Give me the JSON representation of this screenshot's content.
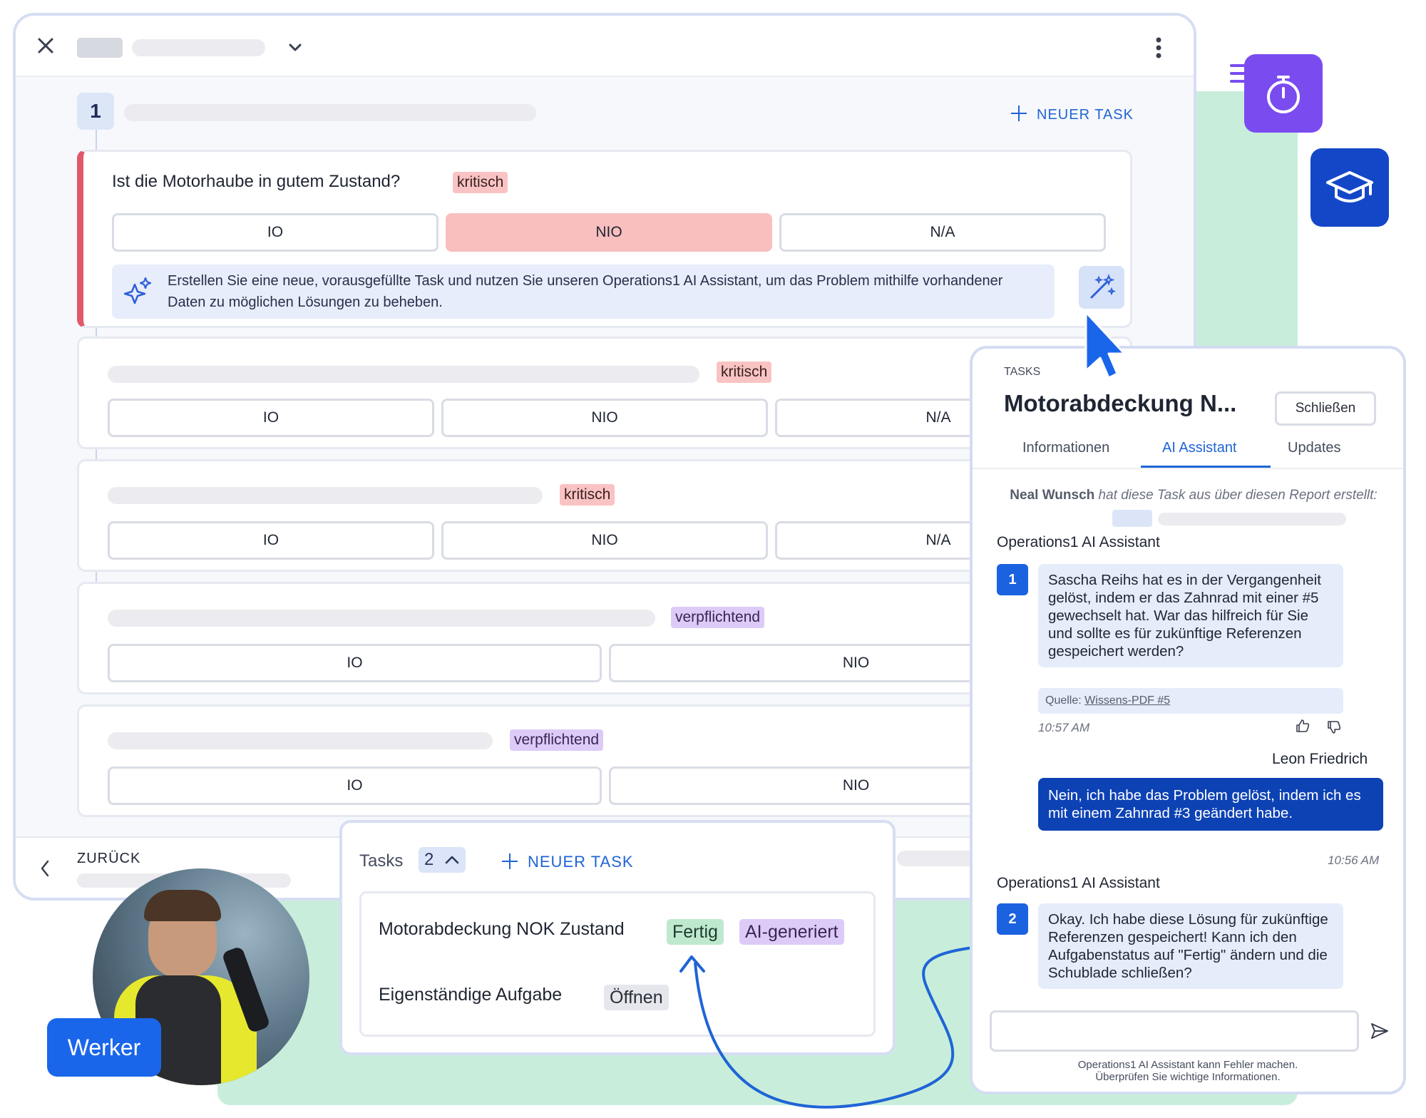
{
  "colors": {
    "accent": "#1f64d6",
    "critical": "#fac3c3",
    "mandatory": "#dccbf7",
    "done": "#bfe9cf",
    "panel_user": "#0d42b5",
    "timer_tile": "#7a4cf0",
    "edu_tile": "#1447c8"
  },
  "icons": {
    "close": "close-icon",
    "chevron": "chevron-down-icon",
    "menu": "more-vertical-icon",
    "timer": "stopwatch-icon",
    "edu": "graduation-cap-icon",
    "sparkle": "sparkles-icon",
    "wand": "magic-wand-icon",
    "cursor": "cursor-arrow-icon",
    "send": "send-icon",
    "thumbs_up": "thumbs-up-icon",
    "thumbs_down": "thumbs-down-icon",
    "back": "chevron-left-icon",
    "up": "chevron-up-icon"
  },
  "step": {
    "number": "1",
    "new_task": "NEUER TASK"
  },
  "questions": [
    {
      "title": "Ist die Motorhaube in gutem Zustand?",
      "tag": "kritisch",
      "options": [
        "IO",
        "NIO",
        "N/A"
      ],
      "selected": "NIO"
    },
    {
      "tag": "kritisch",
      "options": [
        "IO",
        "NIO",
        "N/A"
      ]
    },
    {
      "tag": "kritisch",
      "options": [
        "IO",
        "NIO",
        "N/A"
      ]
    },
    {
      "tag": "verpflichtend",
      "options": [
        "IO",
        "NIO"
      ]
    },
    {
      "tag": "verpflichtend",
      "options": [
        "IO",
        "NIO"
      ]
    }
  ],
  "ai_hint": "Erstellen Sie eine neue, vorausgefüllte Task und nutzen Sie unseren Operations1 AI Assistant, um das Problem mithilfe vorhandener Daten zu möglichen Lösungen zu beheben.",
  "footer": {
    "back": "ZURÜCK"
  },
  "tasks_popup": {
    "title": "Tasks",
    "count": "2",
    "new_task": "NEUER TASK",
    "items": [
      {
        "name": "Motorabdeckung NOK Zustand",
        "status": "Fertig",
        "badge": "AI-generiert"
      },
      {
        "name": "Eigenständige Aufgabe",
        "status": "Öffnen"
      }
    ]
  },
  "panel": {
    "eyebrow": "TASKS",
    "title": "Motorabdeckung N...",
    "close": "Schließen",
    "tabs": [
      "Informationen",
      "AI Assistant",
      "Updates"
    ],
    "active_tab": "AI Assistant",
    "created_by": "Neal Wunsch",
    "created_text": "hat diese Task aus über diesen Report erstellt:",
    "messages": [
      {
        "sender": "Operations1 AI Assistant",
        "number": "1",
        "text": "Sascha Reihs hat es in der Vergangenheit gelöst, indem er das Zahnrad mit einer #5 gewechselt hat. War das hilfreich für Sie und sollte es für zukünftige Referenzen gespeichert werden?",
        "source_label": "Quelle:",
        "source_link": "Wissens-PDF #5",
        "time": "10:57 AM"
      },
      {
        "sender": "Leon Friedrich",
        "text": "Nein, ich habe das Problem gelöst, indem ich es mit einem Zahnrad #3 geändert habe.",
        "time": "10:56 AM"
      },
      {
        "sender": "Operations1 AI Assistant",
        "number": "2",
        "text": "Okay. Ich habe diese Lösung für zukünftige Referenzen gespeichert! Kann ich den Aufgabenstatus auf \"Fertig\" ändern und die Schublade schließen?"
      }
    ],
    "input_placeholder": "",
    "disclaimer_1": "Operations1 AI Assistant kann Fehler machen.",
    "disclaimer_2": "Überprüfen Sie wichtige Informationen."
  },
  "person_label": "Werker"
}
